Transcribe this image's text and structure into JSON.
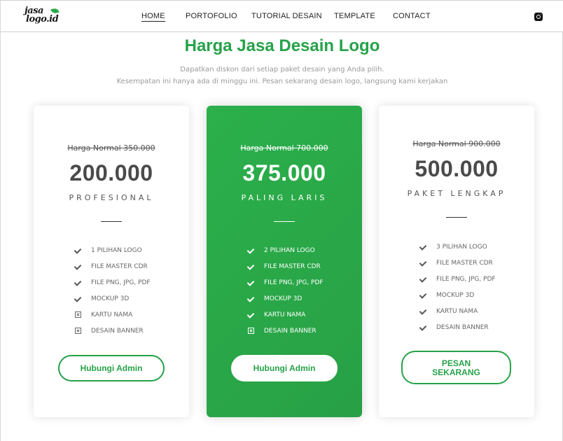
{
  "brand": {
    "line1": "jasa",
    "line2": "logo.id"
  },
  "nav": {
    "items": [
      {
        "label": "HOME"
      },
      {
        "label": "PORTOFOLIO"
      },
      {
        "label": "TUTORIAL DESAIN"
      },
      {
        "label": "TEMPLATE"
      },
      {
        "label": "CONTACT"
      }
    ],
    "active": "HOME",
    "social_icon": "instagram-icon"
  },
  "header": {
    "title": "Harga Jasa Desain Logo",
    "subtitle_line1": "Dapatkan diskon dari setiap paket desain yang Anda pilih.",
    "subtitle_line2": "Kesempatan ini hanya ada di minggu ini. Pesan sekarang desain logo, langsung kami kerjakan"
  },
  "colors": {
    "accent": "#26a249",
    "featured_bg": "#2aad4a"
  },
  "plans": [
    {
      "old_price": "Harga Normal 350.000",
      "price": "200.000",
      "tier": "PROFESIONAL",
      "features": [
        {
          "label": "1 PILIHAN LOGO",
          "included": true
        },
        {
          "label": "FILE MASTER CDR",
          "included": true
        },
        {
          "label": "FILE PNG, JPG, PDF",
          "included": true
        },
        {
          "label": "MOCKUP 3D",
          "included": true
        },
        {
          "label": "KARTU NAMA",
          "included": false
        },
        {
          "label": "DESAIN BANNER",
          "included": false
        }
      ],
      "button": "Hubungi Admin"
    },
    {
      "old_price": "Harga Normal 700.000",
      "price": "375.000",
      "tier": "PALING LARIS",
      "features": [
        {
          "label": "2 PILIHAN LOGO",
          "included": true
        },
        {
          "label": "FILE MASTER CDR",
          "included": true
        },
        {
          "label": "FILE PNG, JPG, PDF",
          "included": true
        },
        {
          "label": "MOCKUP 3D",
          "included": true
        },
        {
          "label": "KARTU NAMA",
          "included": true
        },
        {
          "label": "DESAIN BANNER",
          "included": false
        }
      ],
      "button": "Hubungi Admin"
    },
    {
      "old_price": "Harga Normal 900.000",
      "price": "500.000",
      "tier": "PAKET LENGKAP",
      "features": [
        {
          "label": "3 PILIHAN LOGO",
          "included": true
        },
        {
          "label": "FILE MASTER CDR",
          "included": true
        },
        {
          "label": "FILE PNG, JPG, PDF",
          "included": true
        },
        {
          "label": "MOCKUP 3D",
          "included": true
        },
        {
          "label": "KARTU NAMA",
          "included": true
        },
        {
          "label": "DESAIN BANNER",
          "included": true
        }
      ],
      "button": "PESAN SEKARANG"
    }
  ]
}
